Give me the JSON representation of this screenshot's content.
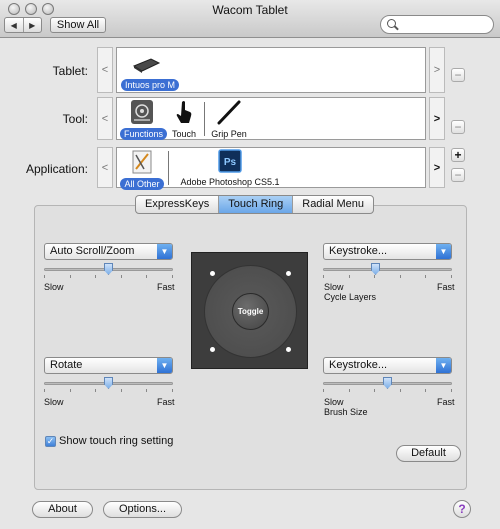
{
  "window": {
    "title": "Wacom Tablet"
  },
  "toolbar": {
    "back": "◀",
    "forward": "▶",
    "show_all": "Show All",
    "search_placeholder": ""
  },
  "rows": {
    "tablet": {
      "label": "Tablet:",
      "items": [
        {
          "name": "Intuos pro M",
          "selected": true
        }
      ]
    },
    "tool": {
      "label": "Tool:",
      "items": [
        {
          "name": "Functions",
          "selected": true
        },
        {
          "name": "Touch",
          "selected": false
        },
        {
          "name": "Grip Pen",
          "selected": false
        }
      ]
    },
    "application": {
      "label": "Application:",
      "items": [
        {
          "name": "All Other",
          "selected": true
        },
        {
          "name": "Adobe Photoshop CS5.1",
          "selected": false
        }
      ]
    },
    "arrow_left": "<",
    "arrow_right": ">",
    "plus": "+",
    "minus": "−"
  },
  "tabs": [
    "ExpressKeys",
    "Touch Ring",
    "Radial Menu"
  ],
  "active_tab": "Touch Ring",
  "controls": {
    "top_left": {
      "value": "Auto Scroll/Zoom",
      "slow": "Slow",
      "fast": "Fast",
      "caption": "",
      "slider_position": 0.5
    },
    "top_right": {
      "value": "Keystroke...",
      "slow": "Slow",
      "fast": "Fast",
      "caption": "Cycle Layers",
      "slider_position": 0.4
    },
    "bottom_left": {
      "value": "Rotate",
      "slow": "Slow",
      "fast": "Fast",
      "caption": "",
      "slider_position": 0.5
    },
    "bottom_right": {
      "value": "Keystroke...",
      "slow": "Slow",
      "fast": "Fast",
      "caption": "Brush Size",
      "slider_position": 0.5
    }
  },
  "ring": {
    "center_label": "Toggle"
  },
  "show_ring_setting": {
    "label": "Show touch ring setting",
    "checked": true,
    "mark": "✓"
  },
  "buttons": {
    "default": "Default",
    "about": "About",
    "options": "Options...",
    "help": "?"
  },
  "caret": "▼"
}
